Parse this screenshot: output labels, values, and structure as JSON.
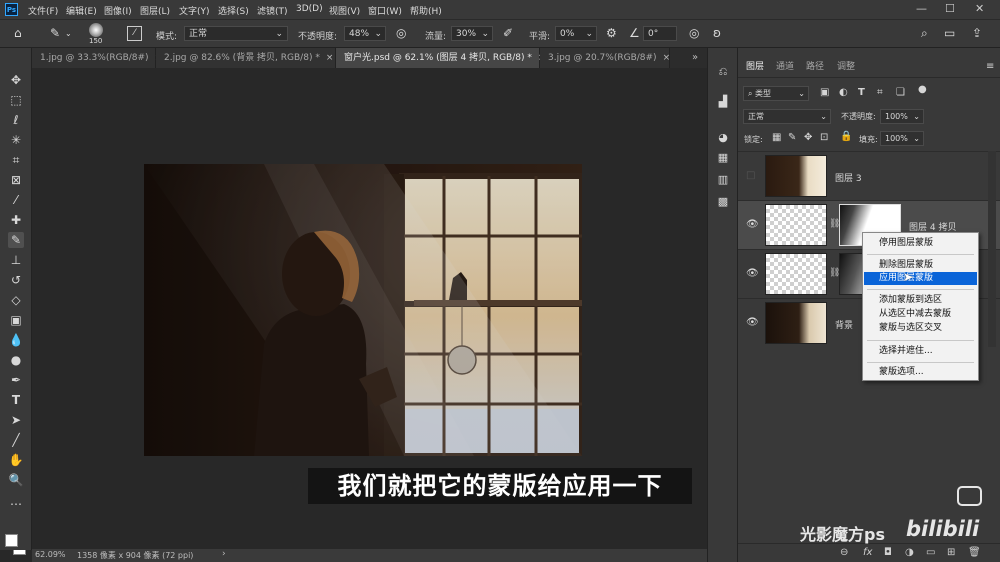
{
  "app": {
    "logo": "Ps"
  },
  "menu": [
    "文件(F)",
    "编辑(E)",
    "图像(I)",
    "图层(L)",
    "文字(Y)",
    "选择(S)",
    "滤镜(T)",
    "3D(D)",
    "视图(V)",
    "窗口(W)",
    "帮助(H)"
  ],
  "window_controls": {
    "minimize": "—",
    "maximize": "☐",
    "close": "✕"
  },
  "options": {
    "brush_size": "150",
    "mode_label": "模式:",
    "mode_value": "正常",
    "opacity_label": "不透明度:",
    "opacity_value": "48%",
    "flow_label": "流量:",
    "flow_value": "30%",
    "smoothing_label": "平滑:",
    "smoothing_value": "0%",
    "angle_value": "0°"
  },
  "tabs": [
    {
      "label": "1.jpg @ 33.3%(RGB/8#)",
      "close": "×"
    },
    {
      "label": "2.jpg @ 82.6% (背景 拷贝, RGB/8) *",
      "close": "×"
    },
    {
      "label": "窗户光.psd @ 62.1% (图层 4 拷贝, RGB/8) *",
      "close": "×"
    },
    {
      "label": "3.jpg @ 20.7%(RGB/8#)",
      "close": "×"
    }
  ],
  "status": {
    "zoom": "62.09%",
    "doc_info": "1358 像素 x 904 像素 (72 ppi)",
    "arrow": "›"
  },
  "layers_panel": {
    "tabs": [
      "图层",
      "通道",
      "路径",
      "调整"
    ],
    "filter_kind": "类型",
    "blend_mode": "正常",
    "opacity_label": "不透明度:",
    "opacity_value": "100%",
    "lock_label": "锁定:",
    "fill_label": "填充:",
    "fill_value": "100%",
    "layers": [
      {
        "name": "图层 3"
      },
      {
        "name": "图层 4 拷贝"
      },
      {
        "name": ""
      },
      {
        "name": "背景"
      }
    ]
  },
  "context_menu": {
    "items": [
      "停用图层蒙版",
      "删除图层蒙版",
      "应用图层蒙版",
      "添加蒙版到选区",
      "从选区中减去蒙版",
      "蒙版与选区交叉",
      "选择并遮住...",
      "蒙版选项..."
    ],
    "highlighted": "应用图层蒙版"
  },
  "bottom_icons": [
    "link-icon",
    "fx-icon",
    "mask-icon",
    "adjustment-icon",
    "group-icon",
    "new-layer-icon",
    "trash-icon"
  ],
  "bottom_labels": {
    "link": "⊖",
    "fx": "fx",
    "mask": "◘",
    "adjust": "◑",
    "group": "▭",
    "new": "⊞",
    "trash": "🗑"
  },
  "subtitle": "我们就把它的蒙版给应用一下",
  "watermark": "光影魔方ps",
  "bilibili": "bilibili",
  "colors": {
    "accent": "#0a64d8",
    "panel": "#393939",
    "canvas": "#282828"
  }
}
